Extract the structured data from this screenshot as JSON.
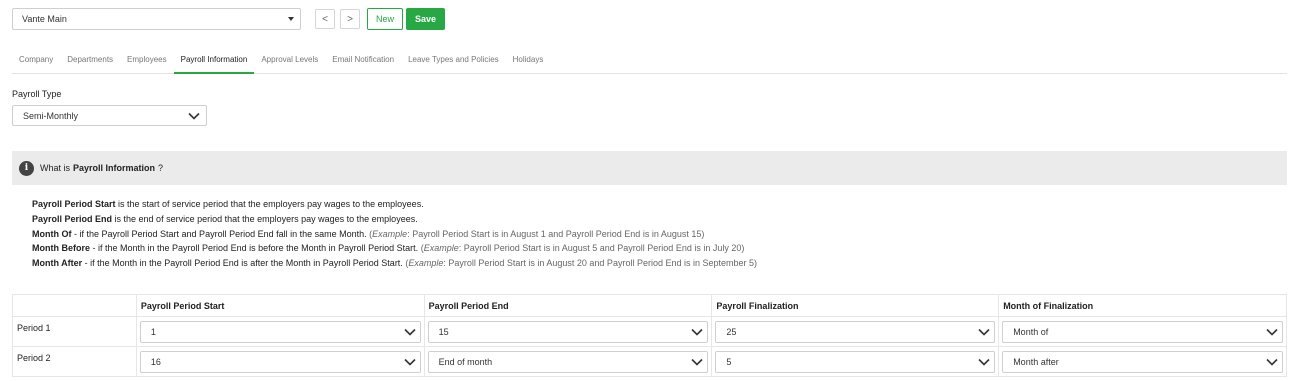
{
  "toolbar": {
    "company": "Vante Main",
    "prev": "<",
    "next": ">",
    "new_label": "New",
    "save_label": "Save"
  },
  "tabs": [
    {
      "label": "Company"
    },
    {
      "label": "Departments"
    },
    {
      "label": "Employees"
    },
    {
      "label": "Payroll Information",
      "active": true
    },
    {
      "label": "Approval Levels"
    },
    {
      "label": "Email Notification"
    },
    {
      "label": "Leave Types and Policies"
    },
    {
      "label": "Holidays"
    }
  ],
  "payroll_type": {
    "label": "Payroll Type",
    "value": "Semi-Monthly"
  },
  "info": {
    "icon": "i",
    "prefix": "What is",
    "bold": "Payroll Information",
    "suffix": "?",
    "lines": [
      {
        "term": "Payroll Period Start",
        "text": " is the start of service period that the employers pay wages to the employees.",
        "example": ""
      },
      {
        "term": "Payroll Period End",
        "text": " is the end of service period that the employers pay wages to the employees.",
        "example": ""
      },
      {
        "term": "Month Of",
        "text": " - if the Payroll Period Start and Payroll Period End fall in the same Month.",
        "example_label": "Example",
        "example": ": Payroll Period Start is in August 1 and Payroll Period End is in August 15)"
      },
      {
        "term": "Month Before",
        "text": " - if the Month in the Payroll Period End is before the Month in Payroll Period Start.",
        "example_label": "Example",
        "example": ": Payroll Period Start is in August 5 and Payroll Period End is in July 20)"
      },
      {
        "term": "Month After",
        "text": " - if the Month in the Payroll Period End is after the Month in Payroll Period Start.",
        "example_label": "Example",
        "example": ": Payroll Period Start is in August 20 and Payroll Period End is in September 5)"
      }
    ]
  },
  "table": {
    "headers": [
      "",
      "Payroll Period Start",
      "Payroll Period End",
      "Payroll Finalization",
      "Month of Finalization"
    ],
    "rows": [
      {
        "label": "Period 1",
        "values": [
          "1",
          "15",
          "25",
          "Month of"
        ]
      },
      {
        "label": "Period 2",
        "values": [
          "16",
          "End of month",
          "5",
          "Month after"
        ]
      }
    ]
  }
}
